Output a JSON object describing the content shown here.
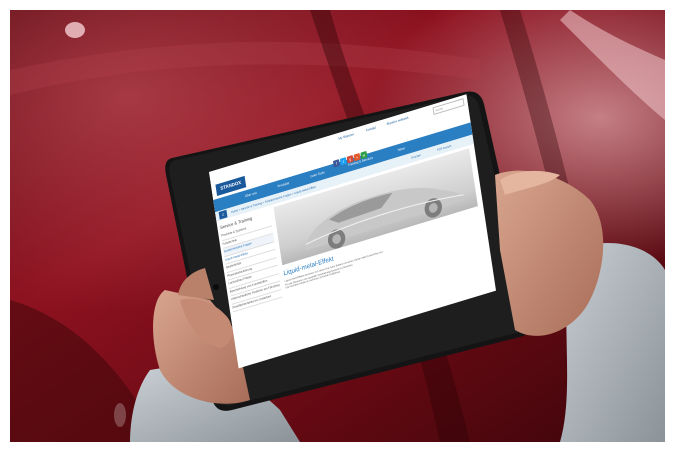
{
  "topbar": {
    "links": [
      "My Standox",
      "Kontakt",
      "Standox weltweit"
    ],
    "search_placeholder": "Suche"
  },
  "logo": "STANDOX",
  "nav": {
    "items": [
      "Über uns",
      "Produkte",
      "Color Tools",
      "Training & Services",
      "News"
    ]
  },
  "subbar": {
    "breadcrumb": "Home > Service & Training > Farbtechnische Fragen > Liquid-metal-Effekt",
    "tools": [
      "Drucken",
      "PDF Ansicht"
    ]
  },
  "sidebar": {
    "title": "Service & Training",
    "items": [
      "Produkte & Systeme",
      "Farbtechnik",
      "Farbtechnische Fragen",
      "Liquid-metal-Effekt",
      "Bedienfehler",
      "Reparaturlackierung",
      "Lackaufbau Flüsse",
      "Beschichtung von Kunststoffen",
      "Unterschiedliche Farbtöne am Fahrzeug",
      "Oberflächenfehler bei Unilacken"
    ]
  },
  "main": {
    "heading": "Liquid-metal-Effekt",
    "paragraph_lines": [
      "Liquid-metal-Effekte zeichnen sich durch eine hohe Brillanz und einen starken Hell-Dunkel-Flop aus.",
      "Für die Reparatur sind spezielle Verarbeitungshinweise zu beachten.",
      "Die Farbtöne werden in mehreren Schichten aufgebaut."
    ]
  },
  "colors": {
    "accent": "#2a7ec2",
    "brand": "#1a5a9c",
    "car_red": "#8a0f1c"
  }
}
